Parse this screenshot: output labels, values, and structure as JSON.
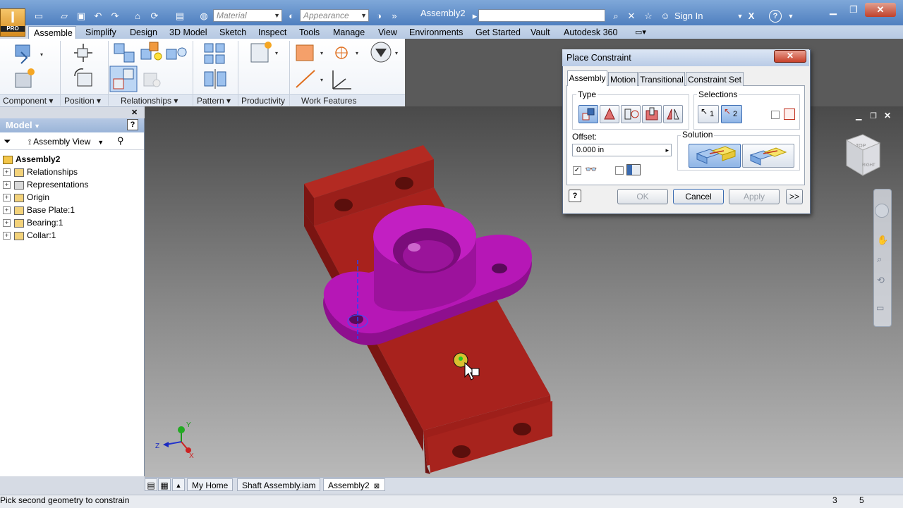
{
  "app": {
    "logo_letter": "I",
    "logo_edition": "PRO",
    "document_title": "Assembly2",
    "material_placeholder": "Material",
    "appearance_placeholder": "Appearance",
    "sign_in": "Sign In",
    "help": "?"
  },
  "ribbon_tabs": [
    "Assemble",
    "Simplify",
    "Design",
    "3D Model",
    "Sketch",
    "Inspect",
    "Tools",
    "Manage",
    "View",
    "Environments",
    "Get Started",
    "Vault",
    "Autodesk 360"
  ],
  "ribbon_groups": [
    "Component",
    "Position",
    "Relationships",
    "Pattern",
    "Productivity",
    "Work Features"
  ],
  "model_panel": {
    "title": "Model",
    "view_label": "Assembly View",
    "root": "Assembly2",
    "items": [
      "Relationships",
      "Representations",
      "Origin",
      "Base Plate:1",
      "Bearing:1",
      "Collar:1"
    ]
  },
  "dialog": {
    "title": "Place Constraint",
    "tabs": [
      "Assembly",
      "Motion",
      "Transitional",
      "Constraint Set"
    ],
    "type_label": "Type",
    "selections_label": "Selections",
    "selection_1": "1",
    "selection_2": "2",
    "offset_label": "Offset:",
    "offset_value": "0.000 in",
    "solution_label": "Solution",
    "ok": "OK",
    "cancel": "Cancel",
    "apply": "Apply",
    "more": ">>"
  },
  "doc_tabs": [
    "My Home",
    "Shaft Assembly.iam",
    "Assembly2"
  ],
  "status": {
    "message": "Pick second geometry to constrain",
    "count1": "3",
    "count2": "5"
  },
  "viewcube": {
    "top": "TOP",
    "right": "RIGHT"
  },
  "axes": {
    "x": "X",
    "y": "Y",
    "z": "Z"
  },
  "colors": {
    "base_plate": "#a8201c",
    "bearing": "#b012b0",
    "ribbon_bg": "#eef2f8",
    "title_bar": "#5a86c2"
  }
}
